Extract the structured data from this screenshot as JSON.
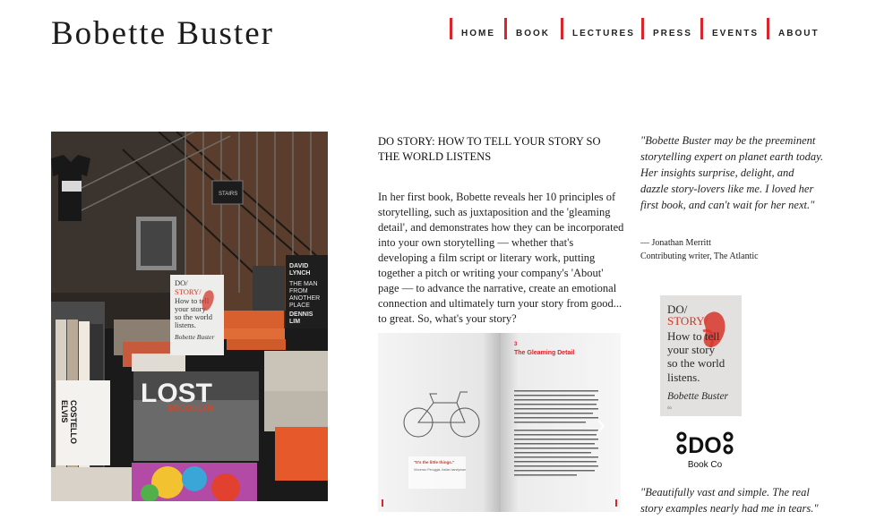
{
  "site": {
    "title": "Bobette Buster"
  },
  "nav": {
    "items": [
      "HOME",
      "BOOK",
      "LECTURES",
      "PRESS",
      "EVENTS",
      "ABOUT"
    ],
    "accent": "#d8262c"
  },
  "book": {
    "title": "DO STORY: HOW TO TELL YOUR STORY SO THE WORLD LISTENS",
    "description": "In her first book, Bobette reveals her 10 principles of storytelling, such as juxtaposition and the 'gleaming detail', and demonstrates how they can be incorporated into your own storytelling — whether that's developing a film script or literary work, putting together a pitch or writing your company's 'About' page — to advance the narrative, create an emotional connection and ultimately turn your story from good... to great.  So, what's your story?"
  },
  "photo": {
    "cover_text": [
      "DO/",
      "STORY/",
      "How to tell",
      "your story",
      "so the world",
      "listens.",
      "Bobette Buster"
    ],
    "lost_title": "LOST",
    "lost_subtitle": "BROOKLYN",
    "lynch_book": [
      "DAVID",
      "LYNCH",
      "THE MAN",
      "FROM",
      "ANOTHER",
      "PLACE",
      "DENNIS",
      "LIM"
    ],
    "elvis_book": [
      "ELVIS",
      "COSTELLO"
    ],
    "stairs_label": "STAIRS"
  },
  "spread": {
    "chapter_number": "3",
    "chapter_title": "The Gleaming Detail",
    "caption": "\"It's the little things.\"",
    "caption_credit": "Vincenzo Peruggia, Italian handyman"
  },
  "quote1": {
    "text": "\"Bobette Buster may be the preeminent storytelling expert on planet earth today. Her insights surprise, delight, and dazzle story-lovers like me. I loved her first book, and can't wait for her next.\"",
    "author": "— Jonathan Merritt",
    "role": "Contributing writer, The Atlantic"
  },
  "cover_thumb": {
    "lines": [
      "DO/",
      "STORY/",
      "How to tell",
      "your story",
      "so the world",
      "listens.",
      "Bobette Buster"
    ],
    "publisher_mark": "do"
  },
  "logo": {
    "main": "DO",
    "sub": "Book Co"
  },
  "quote2": {
    "text": "\"Beautifully vast and simple. The real story examples nearly had me in tears.\""
  }
}
